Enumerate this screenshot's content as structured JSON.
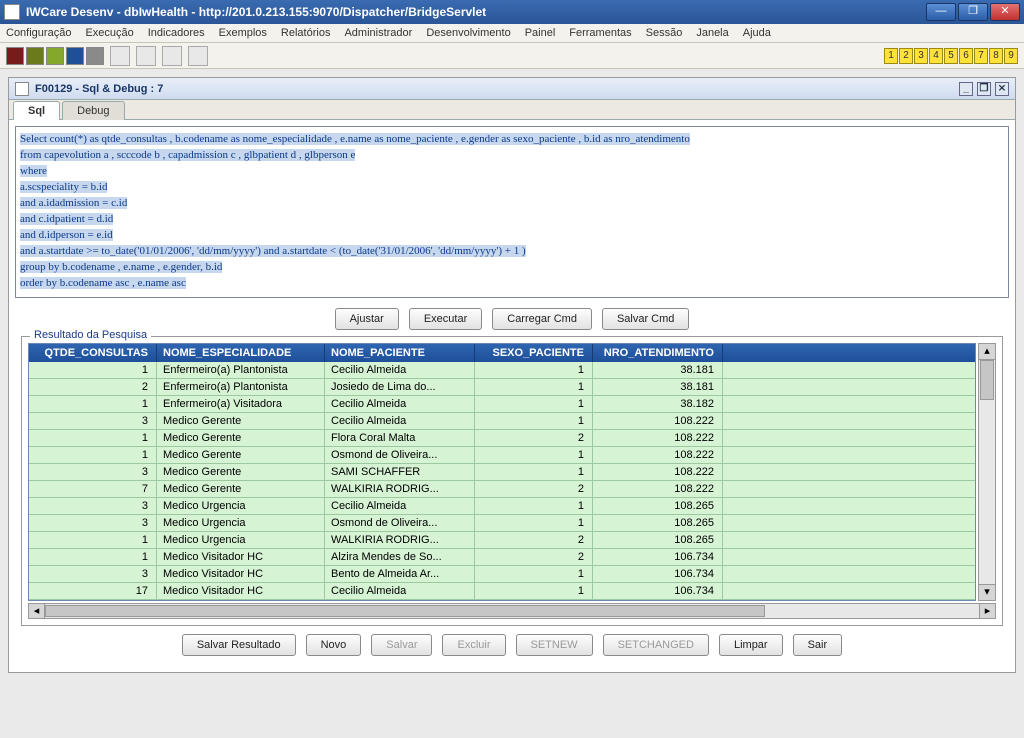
{
  "window": {
    "title": "IWCare Desenv - dbIwHealth - http://201.0.213.155:9070/Dispatcher/BridgeServlet"
  },
  "menu": [
    "Configuração",
    "Execução",
    "Indicadores",
    "Exemplos",
    "Relatórios",
    "Administrador",
    "Desenvolvimento",
    "Painel",
    "Ferramentas",
    "Sessão",
    "Janela",
    "Ajuda"
  ],
  "swatches": [
    "#7a1b1b",
    "#6b7a1b",
    "#84a82a",
    "#1e4f9a",
    "#8a8a8a"
  ],
  "numstrip": [
    "1",
    "2",
    "3",
    "4",
    "5",
    "6",
    "7",
    "8",
    "9"
  ],
  "subwindow": {
    "title": "F00129 - Sql & Debug : 7"
  },
  "tabs": {
    "sql": "Sql",
    "debug": "Debug"
  },
  "sql_lines": [
    "Select count(*) as qtde_consultas , b.codename as nome_especialidade , e.name as nome_paciente , e.gender as sexo_paciente , b.id as nro_atendimento",
    "from capevolution a , scccode b , capadmission c , glbpatient d , glbperson e",
    "where",
    "a.scspeciality = b.id",
    "and a.idadmission = c.id",
    "and c.idpatient = d.id",
    "and d.idperson = e.id",
    "and a.startdate >= to_date('01/01/2006', 'dd/mm/yyyy') and  a.startdate < (to_date('31/01/2006', 'dd/mm/yyyy') + 1 )",
    "group by  b.codename , e.name , e.gender, b.id",
    "order by b.codename asc , e.name asc"
  ],
  "sql_buttons": {
    "ajustar": "Ajustar",
    "executar": "Executar",
    "carregar": "Carregar Cmd",
    "salvar": "Salvar Cmd"
  },
  "result": {
    "legend": "Resultado da Pesquisa",
    "headers": [
      "QTDE_CONSULTAS",
      "NOME_ESPECIALIDADE",
      "NOME_PACIENTE",
      "SEXO_PACIENTE",
      "NRO_ATENDIMENTO"
    ],
    "rows": [
      [
        "1",
        "Enfermeiro(a) Plantonista",
        "Cecilio Almeida",
        "1",
        "38.181"
      ],
      [
        "2",
        "Enfermeiro(a) Plantonista",
        "Josiedo de Lima do...",
        "1",
        "38.181"
      ],
      [
        "1",
        "Enfermeiro(a) Visitadora",
        "Cecilio Almeida",
        "1",
        "38.182"
      ],
      [
        "3",
        "Medico Gerente",
        "Cecilio Almeida",
        "1",
        "108.222"
      ],
      [
        "1",
        "Medico Gerente",
        "Flora Coral Malta",
        "2",
        "108.222"
      ],
      [
        "1",
        "Medico Gerente",
        "Osmond de Oliveira...",
        "1",
        "108.222"
      ],
      [
        "3",
        "Medico Gerente",
        "SAMI SCHAFFER",
        "1",
        "108.222"
      ],
      [
        "7",
        "Medico Gerente",
        "WALKIRIA RODRIG...",
        "2",
        "108.222"
      ],
      [
        "3",
        "Medico Urgencia",
        "Cecilio Almeida",
        "1",
        "108.265"
      ],
      [
        "3",
        "Medico Urgencia",
        "Osmond de Oliveira...",
        "1",
        "108.265"
      ],
      [
        "1",
        "Medico Urgencia",
        "WALKIRIA RODRIG...",
        "2",
        "108.265"
      ],
      [
        "1",
        "Medico Visitador HC",
        "Alzira Mendes de So...",
        "2",
        "106.734"
      ],
      [
        "3",
        "Medico Visitador HC",
        "Bento de Almeida Ar...",
        "1",
        "106.734"
      ],
      [
        "17",
        "Medico Visitador HC",
        "Cecilio Almeida",
        "1",
        "106.734"
      ]
    ]
  },
  "bottom_buttons": {
    "salvar_resultado": "Salvar Resultado",
    "novo": "Novo",
    "salvar": "Salvar",
    "excluir": "Excluir",
    "setnew": "SETNEW",
    "setchanged": "SETCHANGED",
    "limpar": "Limpar",
    "sair": "Sair"
  }
}
